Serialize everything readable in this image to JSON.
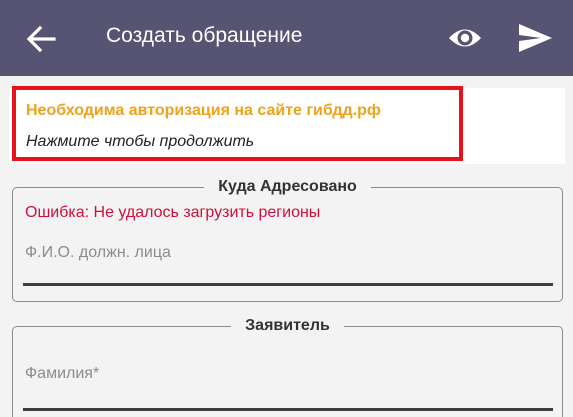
{
  "appbar": {
    "title": "Создать обращение",
    "background": "#575372",
    "icons": [
      "arrow-back-icon",
      "eye-icon",
      "send-icon"
    ]
  },
  "auth_notice": {
    "title": "Необходима авторизация на сайте гибдд.рф",
    "subtitle": "Нажмите чтобы продолжить",
    "title_color": "#efa21b",
    "border_color": "#e8121a"
  },
  "recipient_section": {
    "legend": "Куда Адресовано",
    "error": "Ошибка: Не удалось загрузить регионы",
    "error_color": "#d0103a",
    "official_name_placeholder": "Ф.И.О. должн. лица",
    "official_name_value": ""
  },
  "applicant_section": {
    "legend": "Заявитель",
    "surname_placeholder": "Фамилия*",
    "surname_value": ""
  }
}
